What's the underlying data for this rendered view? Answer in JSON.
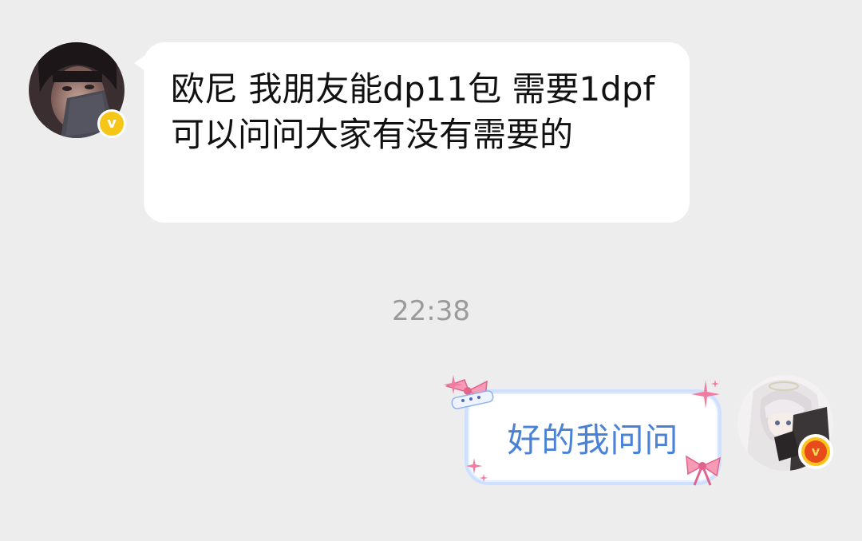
{
  "incoming": {
    "text": "欧尼 我朋友能dp11包 需要1dpf 可以问问大家有没有需要的",
    "badge_label": "v",
    "badge_color": "#f5c518"
  },
  "timestamp": "22:38",
  "outgoing": {
    "text": "好的我问问",
    "text_color": "#4a82d8",
    "badge_label": "v",
    "badge_color": "#e84a1b"
  },
  "icons": {
    "left_avatar": "user-avatar-photo",
    "right_avatar": "user-avatar-anime",
    "left_badge": "vip-badge-icon",
    "right_badge": "vip-badge-icon",
    "bubble_decorations": [
      "ribbon-bow-icon",
      "sparkle-icon"
    ]
  }
}
